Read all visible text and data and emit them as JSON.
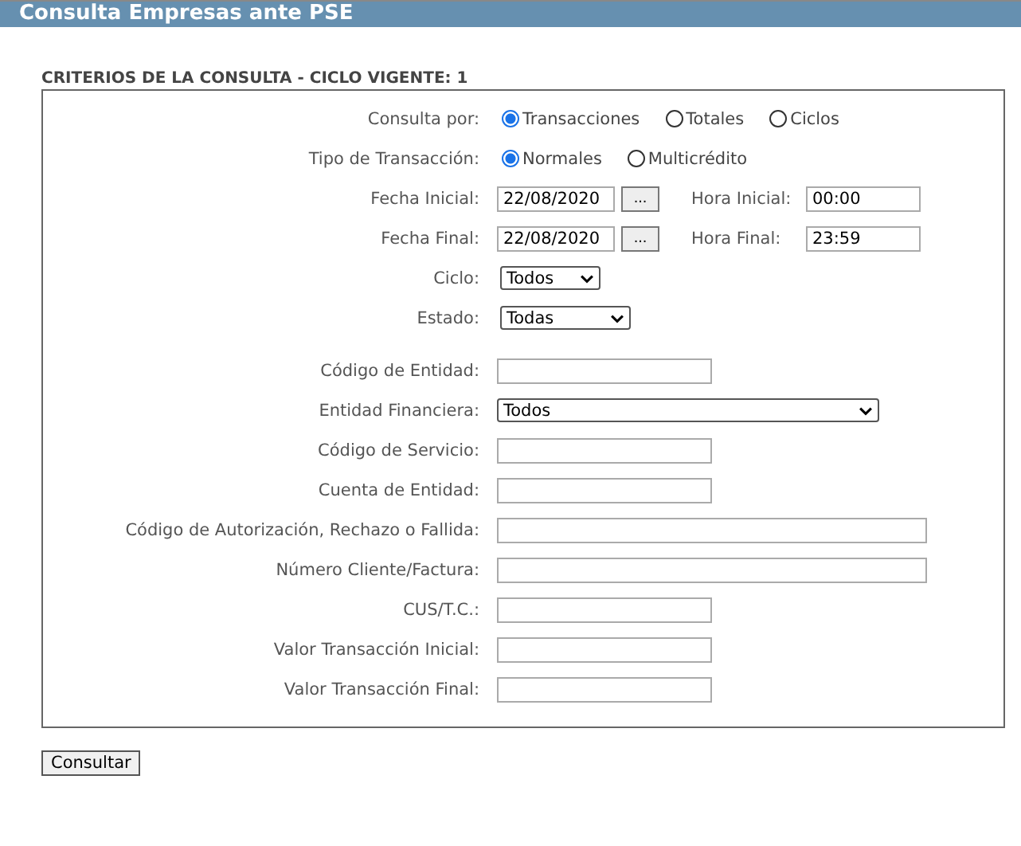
{
  "header": {
    "title": "Consulta Empresas ante PSE"
  },
  "section_title": "CRITERIOS DE LA CONSULTA - CICLO VIGENTE: 1",
  "rows": [
    {
      "kind": "radio",
      "label": "Consulta por:",
      "options": [
        {
          "label": "Transacciones",
          "selected": true
        },
        {
          "label": "Totales",
          "selected": false
        },
        {
          "label": "Ciclos",
          "selected": false
        }
      ]
    },
    {
      "kind": "radio",
      "label": "Tipo de Transacción:",
      "options": [
        {
          "label": "Normales",
          "selected": true
        },
        {
          "label": "Multicrédito",
          "selected": false
        }
      ]
    },
    {
      "kind": "datetime",
      "label": "Fecha Inicial:",
      "date": "22/08/2020",
      "button": "...",
      "time_label": "Hora Inicial:",
      "time": "00:00"
    },
    {
      "kind": "datetime",
      "label": "Fecha Final:",
      "date": "22/08/2020",
      "button": "...",
      "time_label": "Hora Final:",
      "time": "23:59"
    },
    {
      "kind": "select-small",
      "label": "Ciclo:",
      "value": "Todos"
    },
    {
      "kind": "select-medium",
      "label": "Estado:",
      "value": "Todas"
    },
    {
      "kind": "spacer"
    },
    {
      "kind": "text",
      "label": "Código de Entidad:"
    },
    {
      "kind": "select-wide",
      "label": "Entidad Financiera:",
      "value": "Todos"
    },
    {
      "kind": "text",
      "label": "Código de Servicio:"
    },
    {
      "kind": "text",
      "label": "Cuenta de Entidad:"
    },
    {
      "kind": "text-wide",
      "label": "Código de Autorización, Rechazo o Fallida:"
    },
    {
      "kind": "text-wide",
      "label": "Número Cliente/Factura:"
    },
    {
      "kind": "text",
      "label": "CUS/T.C.:"
    },
    {
      "kind": "text",
      "label": "Valor Transacción Inicial:"
    },
    {
      "kind": "text",
      "label": "Valor Transacción Final:"
    }
  ],
  "submit_button": "Consultar"
}
